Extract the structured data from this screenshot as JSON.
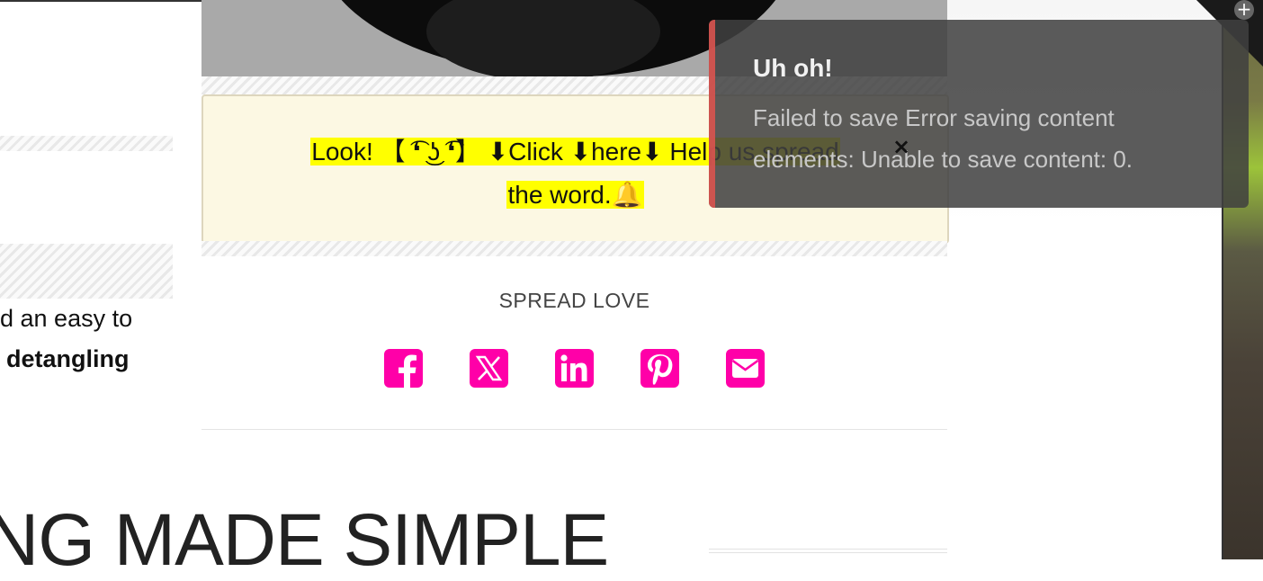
{
  "callout": {
    "line1": "Look! 【 ͡❛ ͜ʖ ͡❛】 ⬇Click ⬇here⬇ Help us spread",
    "line2": "the word.🔔"
  },
  "left": {
    "text_line1": "d an easy to",
    "text_line2": "detangling"
  },
  "share": {
    "label": "SPREAD LOVE",
    "accent_color": "#ff00a8",
    "buttons": [
      "facebook-icon",
      "x-icon",
      "linkedin-icon",
      "pinterest-icon",
      "email-icon"
    ]
  },
  "heading": {
    "text": "NG MADE SIMPLE"
  },
  "toast": {
    "title": "Uh oh!",
    "message": "Failed to save Error saving content elements: Unable to save content: 0.",
    "close_glyph": "×",
    "accent_color": "#d9534f"
  },
  "corner": {
    "plus_glyph": "+"
  }
}
